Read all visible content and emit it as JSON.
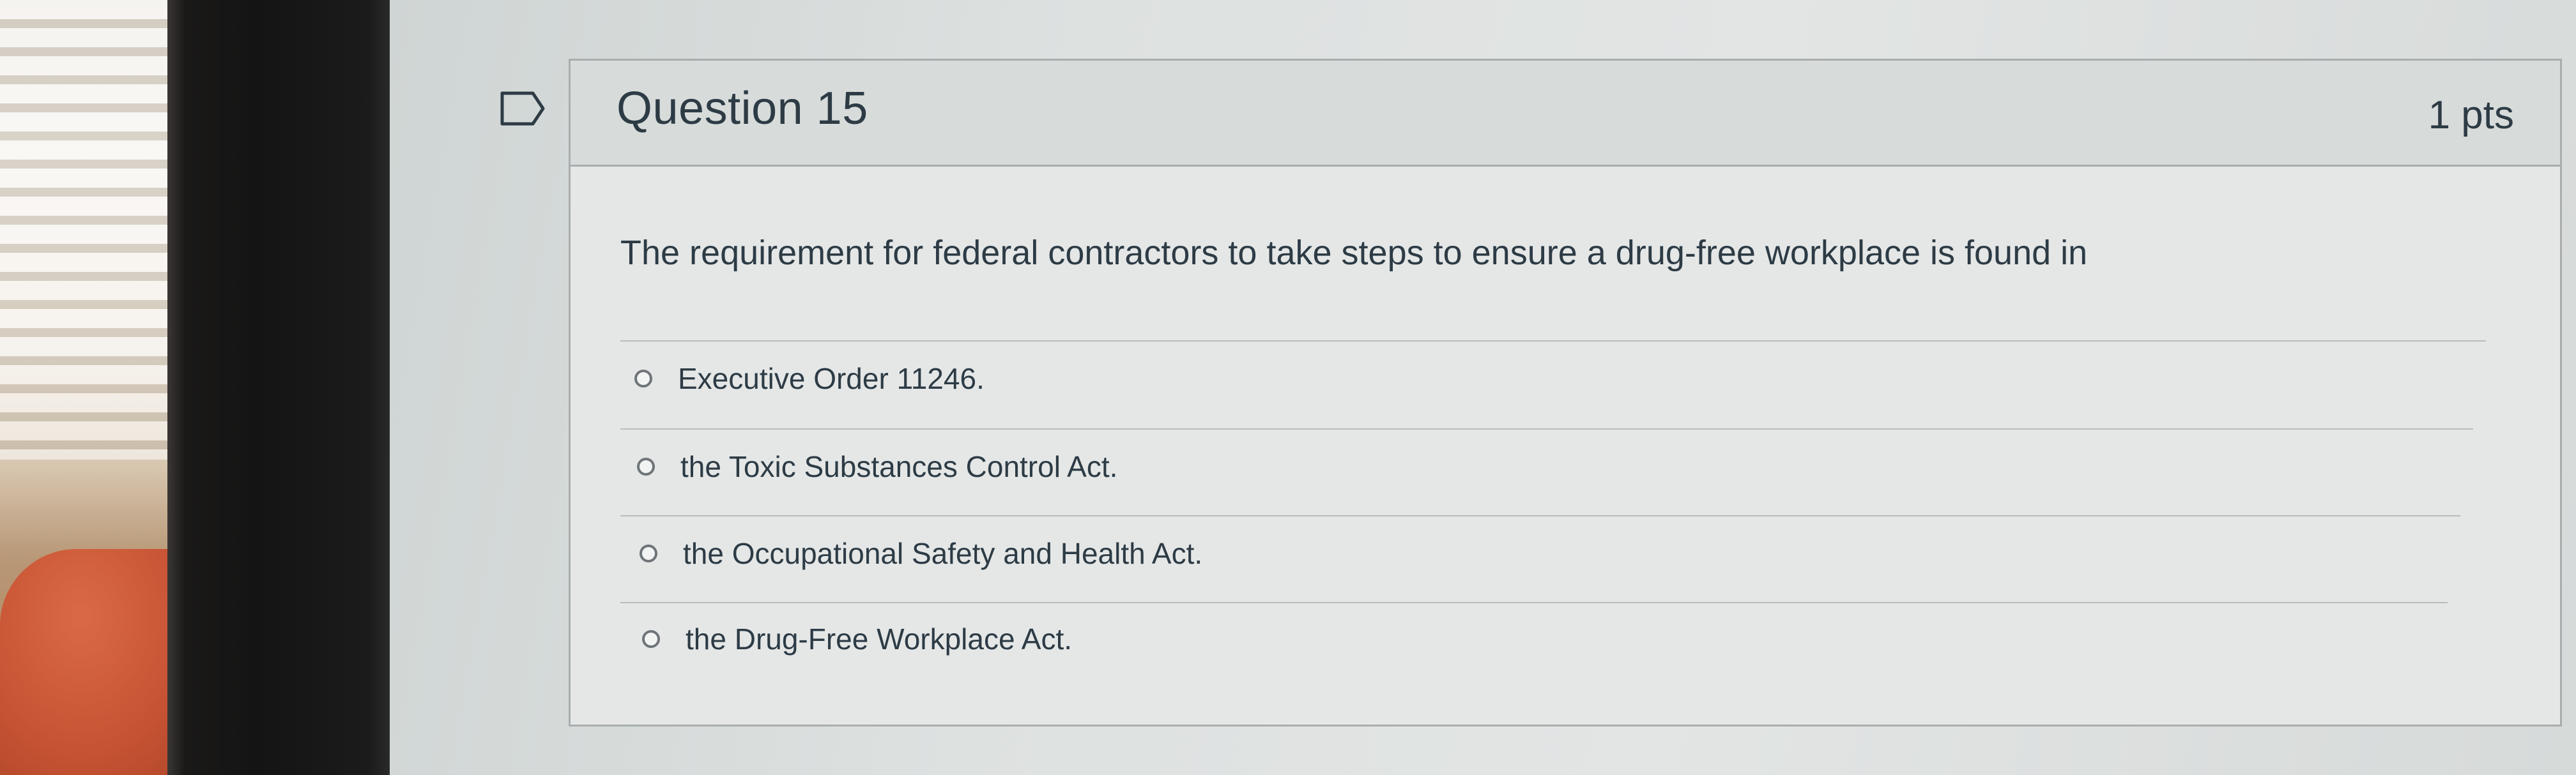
{
  "question": {
    "title": "Question 15",
    "points": "1 pts",
    "text": "The requirement for federal contractors to take steps to ensure a drug-free workplace is found in",
    "flag_icon": "bookmark-flag-icon",
    "answers": [
      {
        "label": "Executive Order 11246.",
        "selected": false
      },
      {
        "label": "the Toxic Substances Control Act.",
        "selected": false
      },
      {
        "label": "the Occupational Safety and Health Act.",
        "selected": false
      },
      {
        "label": "the Drug-Free Workplace Act.",
        "selected": false
      }
    ]
  },
  "colors": {
    "text": "#2d3b45",
    "card_border": "#a9adae",
    "header_bg": "#d7dbda"
  }
}
